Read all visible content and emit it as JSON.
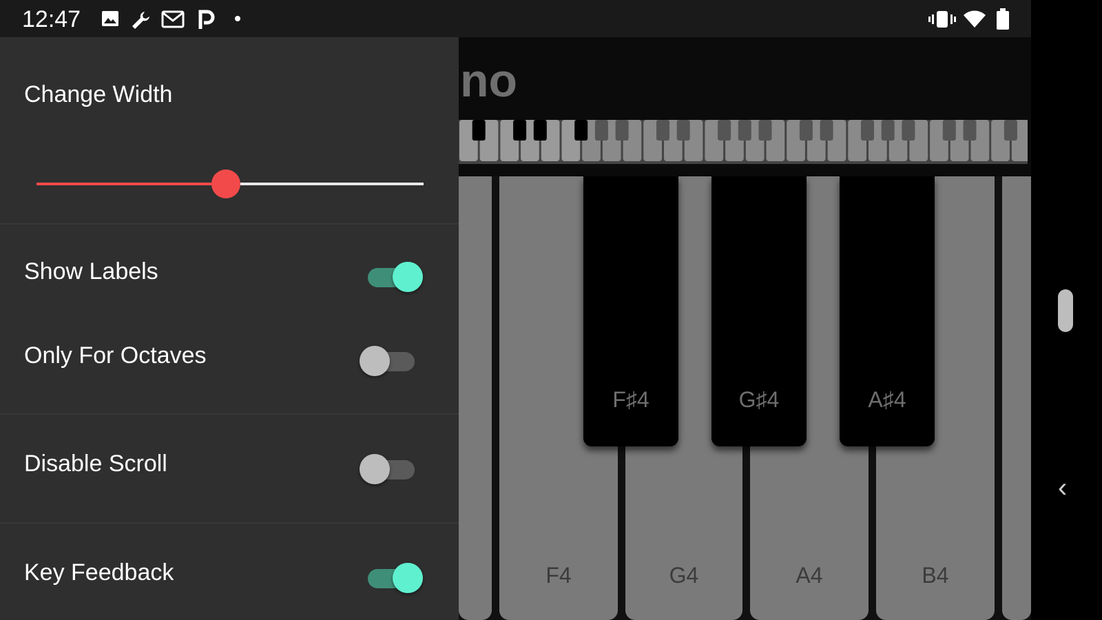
{
  "status_bar": {
    "time": "12:47",
    "left_icons": [
      "image-icon",
      "wrench-icon",
      "gmail-icon",
      "p-app-icon",
      "dot-icon"
    ],
    "right_icons": [
      "vibrate-icon",
      "wifi-icon",
      "battery-icon"
    ]
  },
  "app": {
    "title_fragment": "no"
  },
  "drawer": {
    "section_title": "Change Width",
    "slider_value_fraction": 0.5,
    "settings": [
      {
        "label": "Show Labels",
        "on": true
      },
      {
        "label": "Only For Octaves",
        "on": false
      },
      {
        "label": "Disable Scroll",
        "on": false
      },
      {
        "label": "Key Feedback",
        "on": true
      }
    ]
  },
  "piano": {
    "white_keys": [
      "F4",
      "G4",
      "A4",
      "B4"
    ],
    "black_keys": [
      "F♯4",
      "G♯4",
      "A♯4"
    ]
  },
  "colors": {
    "accent_slider": "#f24a4a",
    "toggle_on": "#5ff0cf",
    "drawer_bg": "#2f2f2f"
  }
}
